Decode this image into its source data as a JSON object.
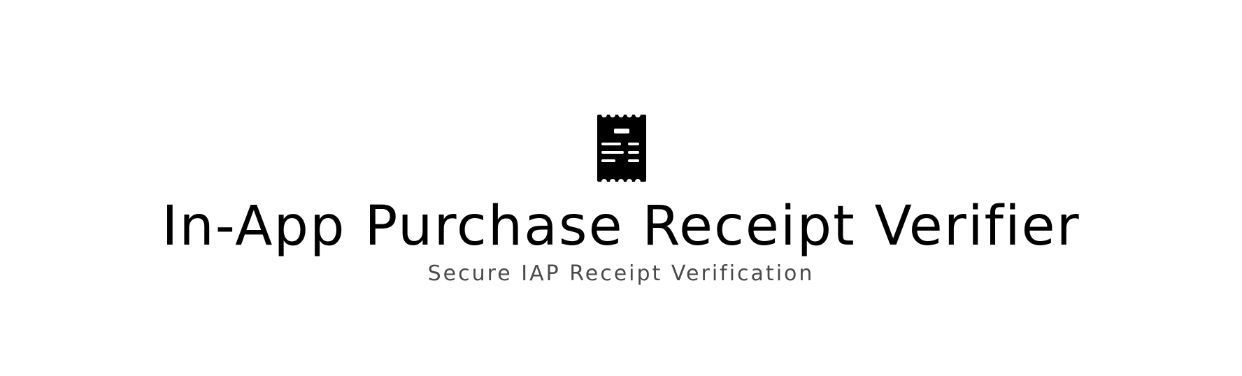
{
  "header": {
    "icon": "receipt-icon",
    "title": "In-App Purchase Receipt Verifier",
    "subtitle": "Secure IAP Receipt Verification"
  },
  "colors": {
    "background": "#ffffff",
    "title": "#000000",
    "subtitle": "#4a4a4a",
    "icon": "#000000"
  }
}
